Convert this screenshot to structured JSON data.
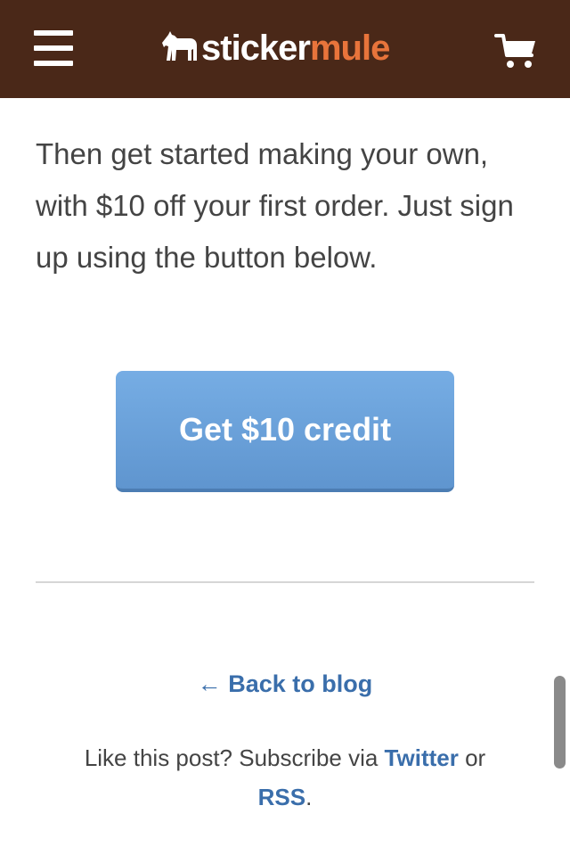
{
  "header": {
    "menu_icon": "hamburger-menu-icon",
    "logo": {
      "part1": "sticker",
      "part2": "mule",
      "icon": "mule-icon"
    },
    "cart_icon": "shopping-cart-icon"
  },
  "content": {
    "paragraph": "Then get started making your own, with $10 off your first order. Just sign up using the button below.",
    "cta_label": "Get $10 credit"
  },
  "footer": {
    "back_link": "← Back to blog",
    "subscribe_prefix": "Like this post? Subscribe via ",
    "twitter": "Twitter",
    "or": " or ",
    "rss": "RSS",
    "period": "."
  },
  "colors": {
    "header_bg": "#4a2818",
    "brand_orange": "#e8743b",
    "button_blue": "#6ba1dc",
    "link_blue": "#3a6eab"
  }
}
